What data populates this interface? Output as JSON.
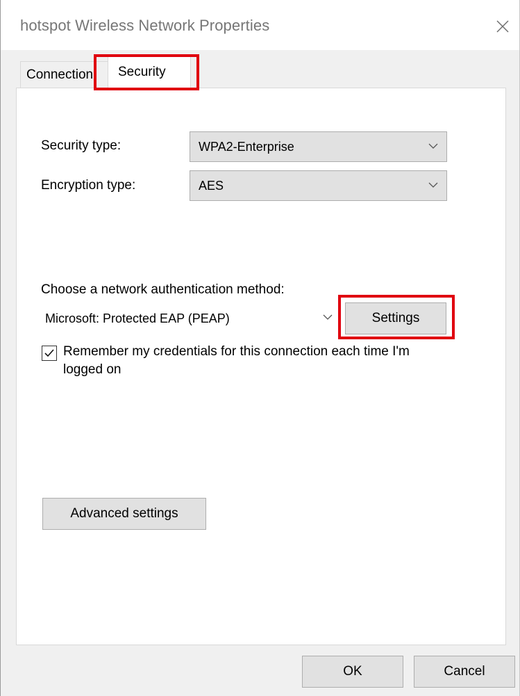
{
  "window": {
    "title": "hotspot Wireless Network Properties"
  },
  "tabs": [
    {
      "label": "Connection",
      "active": false
    },
    {
      "label": "Security",
      "active": true
    }
  ],
  "security": {
    "security_type_label": "Security type:",
    "security_type_value": "WPA2-Enterprise",
    "encryption_type_label": "Encryption type:",
    "encryption_type_value": "AES",
    "auth_method_label": "Choose a network authentication method:",
    "auth_method_value": "Microsoft: Protected EAP (PEAP)",
    "settings_button": "Settings",
    "remember_credentials_label": "Remember my credentials for this connection each time I'm logged on",
    "remember_credentials_checked": true,
    "advanced_settings_button": "Advanced settings"
  },
  "footer": {
    "ok_button": "OK",
    "cancel_button": "Cancel"
  },
  "icons": {
    "close": "close-icon",
    "dropdown": "chevron-down-icon",
    "check": "checkmark-icon"
  },
  "colors": {
    "highlight": "#e0000f",
    "button_face": "#e1e1e1",
    "dialog_bg": "#f0f0f0"
  }
}
